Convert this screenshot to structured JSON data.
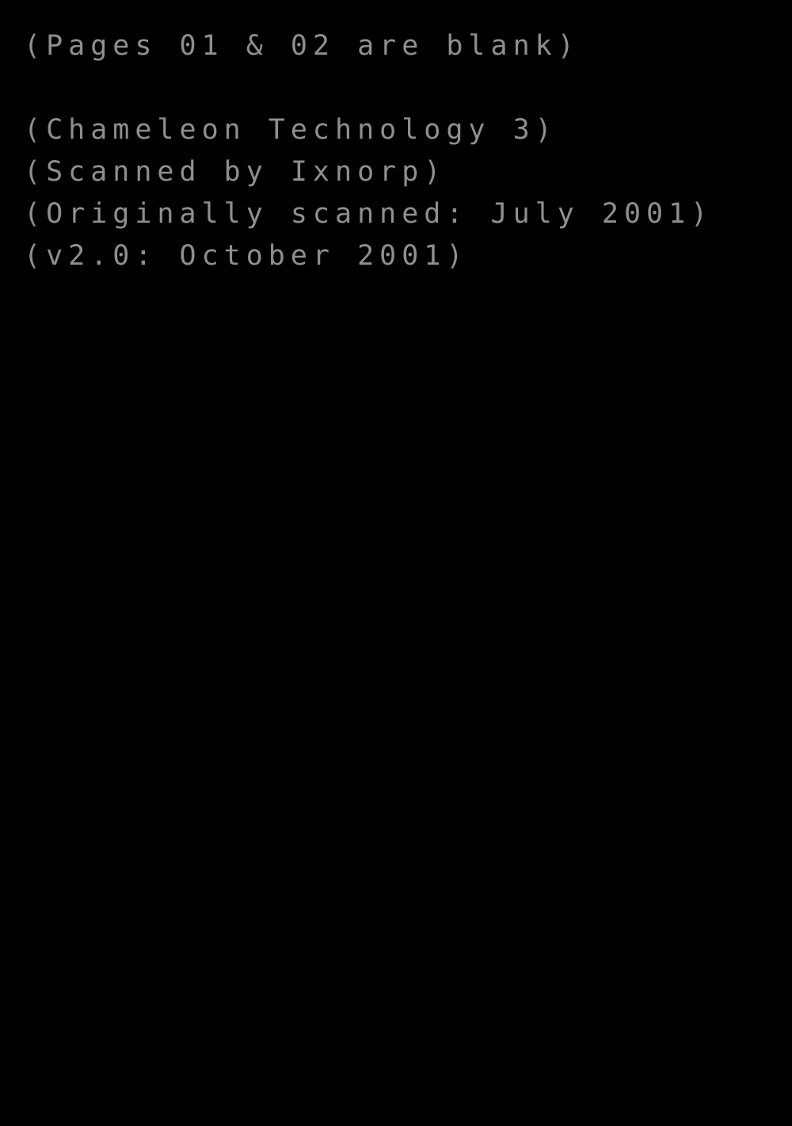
{
  "document": {
    "background_color": "#000000",
    "text_color": "#8f8f8f",
    "title": "Chameleon Technology 3 scan note page",
    "lines": [
      {
        "id": "blank-pages-note",
        "text": "(Pages 01 & 02 are blank)"
      },
      {
        "id": "spacer",
        "text": " "
      },
      {
        "id": "publication-note",
        "text": "(Chameleon Technology 3)"
      },
      {
        "id": "scanned-by-note",
        "text": "(Scanned by Ixnorp)"
      },
      {
        "id": "original-scan-date-note",
        "text": "(Originally scanned: July 2001)"
      },
      {
        "id": "version-note",
        "text": "(v2.0: October 2001)"
      }
    ]
  }
}
